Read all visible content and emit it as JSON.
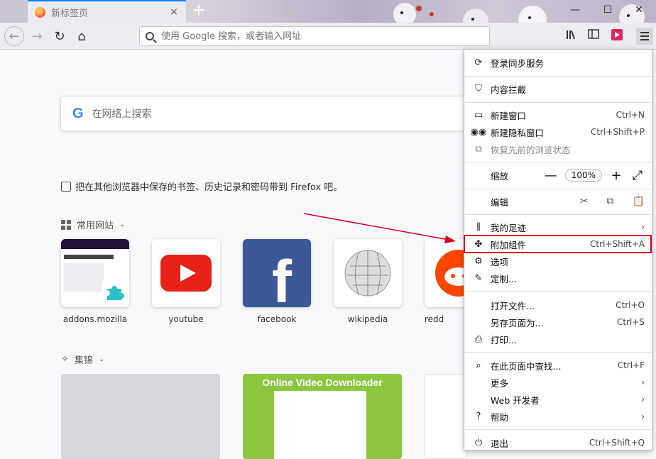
{
  "tab": {
    "title": "新标签页",
    "close": "×"
  },
  "toolbar": {
    "back": "←",
    "forward": "→",
    "reload": "↻",
    "home": "⌂",
    "url_placeholder": "使用 Google 搜索，或者输入网址",
    "new_tab": "+",
    "window_controls": [
      "—",
      "☐",
      "✕"
    ]
  },
  "page": {
    "search_logo": "G",
    "search_placeholder": "在网络上搜索",
    "import_text": "把在其他浏览器中保存的书签、历史记录和密码带到 Firefox 吧。",
    "top_sites_heading": "常用网站",
    "highlights_heading": "集锦",
    "top_sites": [
      {
        "label": "addons.mozilla"
      },
      {
        "label": "youtube"
      },
      {
        "label": "facebook"
      },
      {
        "label": "wikipedia"
      },
      {
        "label": "redd"
      }
    ],
    "highlight_card_title": "Online Video Downloader"
  },
  "menu": {
    "sync": "登录同步服务",
    "content_blocking": "内容拦截",
    "new_window": {
      "label": "新建窗口",
      "shortcut": "Ctrl+N"
    },
    "new_private": {
      "label": "新建隐私窗口",
      "shortcut": "Ctrl+Shift+P"
    },
    "restore_session": "恢复先前的浏览状态",
    "zoom": {
      "label": "缩放",
      "minus": "—",
      "value": "100%",
      "plus": "+",
      "fullscreen": "⤢"
    },
    "edit": {
      "label": "编辑",
      "cut": "✂",
      "copy": "⧉",
      "paste": "📋"
    },
    "library": "我的足迹",
    "addons": {
      "label": "附加组件",
      "shortcut": "Ctrl+Shift+A"
    },
    "options": "选项",
    "customize": "定制...",
    "open_file": {
      "label": "打开文件...",
      "shortcut": "Ctrl+O"
    },
    "save_page": {
      "label": "另存页面为...",
      "shortcut": "Ctrl+S"
    },
    "print": "打印...",
    "find": {
      "label": "在此页面中查找...",
      "shortcut": "Ctrl+F"
    },
    "more": "更多",
    "web_dev": "Web 开发者",
    "help": "帮助",
    "quit": {
      "label": "退出",
      "shortcut": "Ctrl+Shift+Q"
    }
  }
}
